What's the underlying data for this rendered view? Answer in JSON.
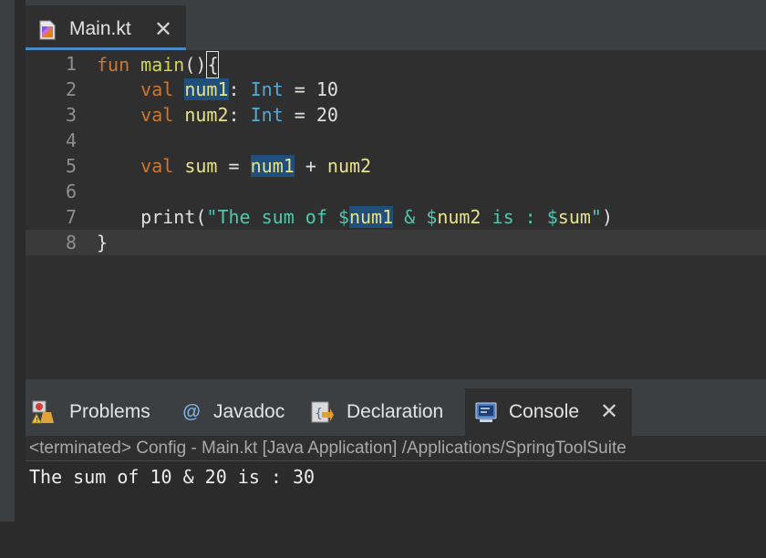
{
  "editor": {
    "tab_label": "Main.kt",
    "line_numbers": [
      "1",
      "2",
      "3",
      "4",
      "5",
      "6",
      "7",
      "8"
    ],
    "code": {
      "l1": {
        "kw": "fun",
        "fn": "main",
        "paren": "()",
        "brace": "{"
      },
      "l2": {
        "kw": "val",
        "name": "num1",
        "colon": ":",
        "type": "Int",
        "assign": "= 10"
      },
      "l3": {
        "kw": "val",
        "name": "num2",
        "colon": ":",
        "type": "Int",
        "assign": "= 20"
      },
      "l5": {
        "kw": "val",
        "name": "sum",
        "eq": "=",
        "a": "num1",
        "plus": "+",
        "b": "num2"
      },
      "l7": {
        "fn": "print(",
        "s1": "\"The sum of $",
        "v1": "num1",
        "s2": " & $",
        "v2": "num2",
        "s3": " is : $",
        "v3": "sum",
        "s4": "\"",
        "close": ")"
      },
      "l8": "}"
    }
  },
  "panel": {
    "tabs": [
      {
        "label": "Problems"
      },
      {
        "label": "Javadoc"
      },
      {
        "label": "Declaration"
      },
      {
        "label": "Console",
        "active": true
      }
    ],
    "console_status": "<terminated> Config - Main.kt [Java Application] /Applications/SpringToolSuite",
    "console_output": "The sum of 10 & 20 is : 30"
  }
}
